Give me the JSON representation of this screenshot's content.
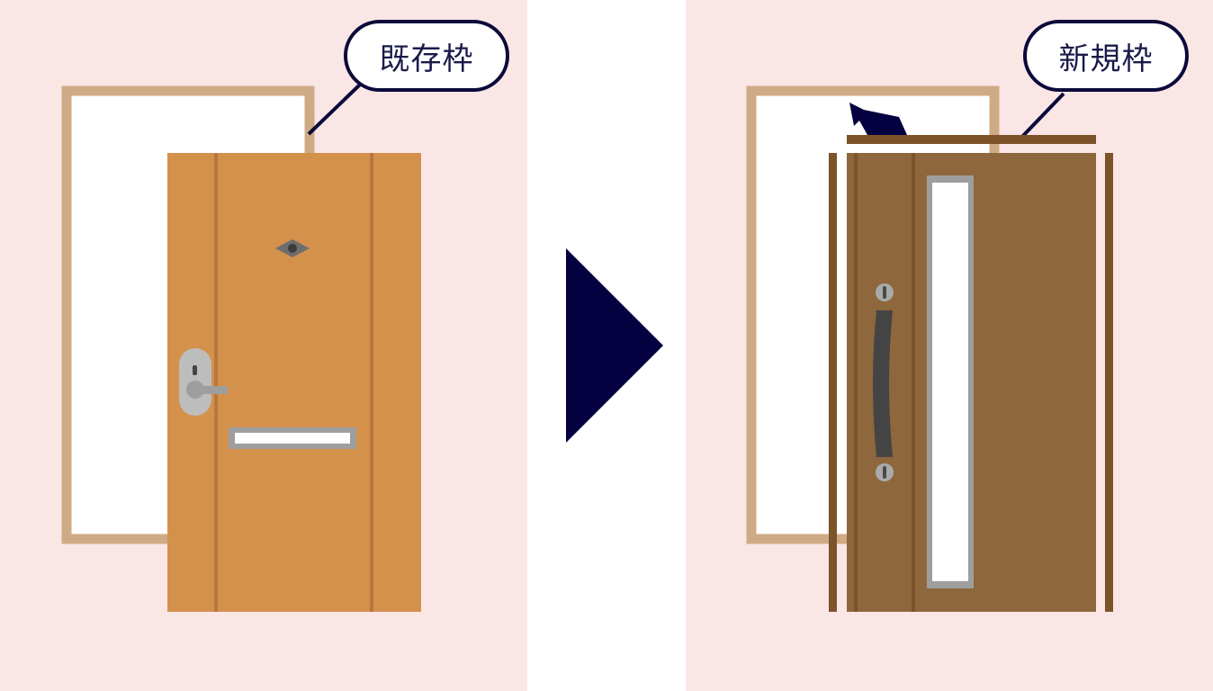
{
  "colors": {
    "panel_bg": "#fbe6e6",
    "old_frame": "#cfab85",
    "old_door": "#d4914c",
    "old_door_groove": "#b6783d",
    "new_door": "#8e673c",
    "new_frame": "#7d5329",
    "arrow": "#050040",
    "label_border": "#0c0a3a"
  },
  "before": {
    "label": "既存枠",
    "icons": [
      "door-viewer-icon",
      "lever-handle-icon",
      "mail-slot-icon"
    ]
  },
  "after": {
    "label": "新規枠",
    "icons": [
      "removal-arrow-icon",
      "pull-handle-icon",
      "glass-slit-icon"
    ]
  },
  "transition": {
    "icon": "right-triangle-arrow-icon"
  }
}
